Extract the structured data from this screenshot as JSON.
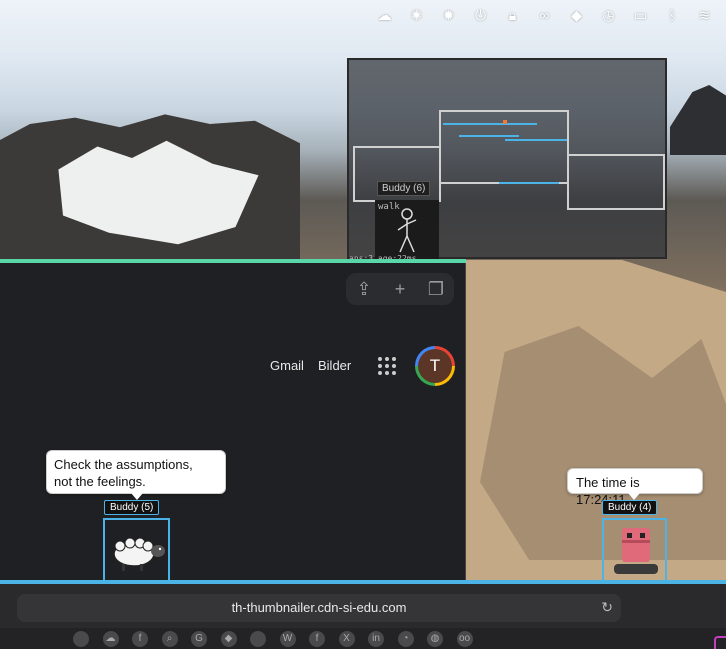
{
  "menubar": {
    "icons": [
      "cloud-icon",
      "openai-icon",
      "bug-icon",
      "power-icon",
      "lock-icon",
      "glasses-icon",
      "cube-icon",
      "clock-icon",
      "battery-icon",
      "bluetooth-icon",
      "wifi-icon"
    ]
  },
  "overlay": {
    "buddy_label": "Buddy (6)",
    "walk_text": "walk",
    "footer_text": "ans:3 age:22ms"
  },
  "browser": {
    "gmail": "Gmail",
    "bilder": "Bilder",
    "avatar_letter": "T"
  },
  "bubbles": {
    "left_line1": "Check the assumptions,",
    "left_line2": "not the feelings.",
    "right": "The time is 17:24:11."
  },
  "buddies": {
    "left": "Buddy (5)",
    "right": "Buddy (4)"
  },
  "addressbar": {
    "url": "th-thumbnailer.cdn-si-edu.com"
  },
  "colors": {
    "accent_blue": "#4cb3e6",
    "accent_green": "#5ad7a8",
    "panel_dark": "#1f2023"
  }
}
